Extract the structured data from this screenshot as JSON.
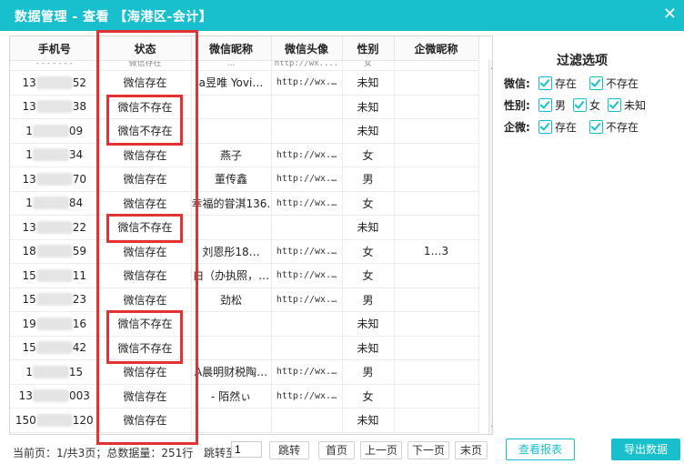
{
  "window": {
    "title": "数据管理 - 查看 【海港区-会计】",
    "close_glyph": "✕"
  },
  "table": {
    "headers": [
      "手机号",
      "状态",
      "微信昵称",
      "微信头像",
      "性别",
      "企微昵称"
    ],
    "partial_row": {
      "status": "微信存在",
      "nickname": "...",
      "avatar": "http://wx....",
      "gender": "女"
    },
    "rows": [
      {
        "phone_prefix": "13",
        "phone_suffix": "52",
        "status": "微信存在",
        "nickname": "a昱唯 Yovi…",
        "avatar": "http://wx.…",
        "gender": "未知",
        "wecom": ""
      },
      {
        "phone_prefix": "13",
        "phone_suffix": "38",
        "status": "微信不存在",
        "nickname": "",
        "avatar": "",
        "gender": "未知",
        "wecom": ""
      },
      {
        "phone_prefix": "1",
        "phone_suffix": "09",
        "status": "微信不存在",
        "nickname": "",
        "avatar": "",
        "gender": "未知",
        "wecom": ""
      },
      {
        "phone_prefix": "1",
        "phone_suffix": "34",
        "status": "微信存在",
        "nickname": "燕子",
        "avatar": "http://wx.…",
        "gender": "女",
        "wecom": ""
      },
      {
        "phone_prefix": "13",
        "phone_suffix": "70",
        "status": "微信存在",
        "nickname": "董传鑫",
        "avatar": "http://wx.…",
        "gender": "男",
        "wecom": ""
      },
      {
        "phone_prefix": "1",
        "phone_suffix": "84",
        "status": "微信存在",
        "nickname": "幸福的甞淇136…",
        "avatar": "http://wx.…",
        "gender": "女",
        "wecom": ""
      },
      {
        "phone_prefix": "13",
        "phone_suffix": "22",
        "status": "微信不存在",
        "nickname": "",
        "avatar": "",
        "gender": "未知",
        "wecom": ""
      },
      {
        "phone_prefix": "18",
        "phone_suffix": "59",
        "status": "微信存在",
        "nickname": "刘恩彤18…",
        "avatar": "http://wx.…",
        "gender": "女",
        "wecom": "1…3"
      },
      {
        "phone_prefix": "15",
        "phone_suffix": "11",
        "status": "微信存在",
        "nickname": "白（办执照，…",
        "avatar": "http://wx.…",
        "gender": "女",
        "wecom": ""
      },
      {
        "phone_prefix": "15",
        "phone_suffix": "23",
        "status": "微信存在",
        "nickname": "劲松",
        "avatar": "http://wx.…",
        "gender": "男",
        "wecom": ""
      },
      {
        "phone_prefix": "19",
        "phone_suffix": "16",
        "status": "微信不存在",
        "nickname": "",
        "avatar": "",
        "gender": "未知",
        "wecom": ""
      },
      {
        "phone_prefix": "15",
        "phone_suffix": "42",
        "status": "微信不存在",
        "nickname": "",
        "avatar": "",
        "gender": "未知",
        "wecom": ""
      },
      {
        "phone_prefix": "1",
        "phone_suffix": "15",
        "status": "微信存在",
        "nickname": "A晨明财税陶…",
        "avatar": "http://wx.…",
        "gender": "男",
        "wecom": ""
      },
      {
        "phone_prefix": "13",
        "phone_suffix": "003",
        "status": "微信存在",
        "nickname": "- 陌然ぃ",
        "avatar": "http://wx.…",
        "gender": "女",
        "wecom": ""
      },
      {
        "phone_prefix": "150",
        "phone_suffix": "120",
        "status": "微信存在",
        "nickname": "",
        "avatar": "",
        "gender": "未知",
        "wecom": ""
      }
    ]
  },
  "pagination": {
    "info": "当前页：1/共3页；总数据量：251行",
    "jump_label": "跳转至",
    "jump_value": "1",
    "go": "跳转",
    "first": "首页",
    "prev": "上一页",
    "next": "下一页",
    "last": "末页"
  },
  "filter": {
    "title": "过滤选项",
    "wechat_label": "微信:",
    "wechat_exist": "存在",
    "wechat_not_exist": "不存在",
    "gender_label": "性别:",
    "male": "男",
    "female": "女",
    "unknown": "未知",
    "wecom_label": "企微:",
    "wecom_exist": "存在",
    "wecom_not_exist": "不存在"
  },
  "actions": {
    "view_report": "查看报表",
    "export": "导出数据"
  },
  "colors": {
    "accent": "#17c0cc",
    "highlight": "#e23232"
  }
}
